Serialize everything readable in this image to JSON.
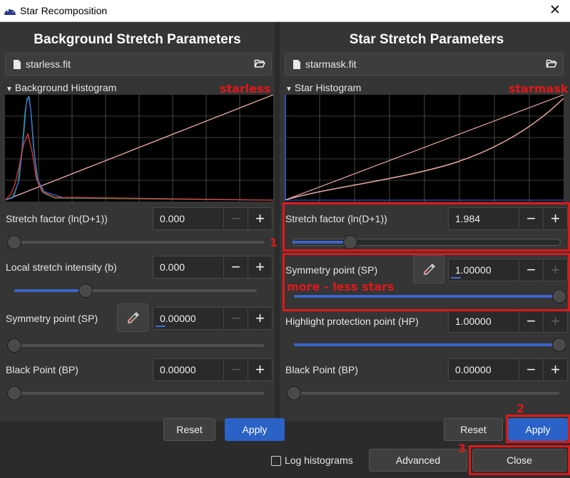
{
  "window": {
    "title": "Star Recomposition",
    "close_icon": "close-icon"
  },
  "left": {
    "heading": "Background Stretch Parameters",
    "file_name": "starless.fit",
    "histogram_title": "Background Histogram",
    "histogram_annotation": "starless",
    "params": {
      "stretch_factor": {
        "label": "Stretch factor (ln(D+1))",
        "value": "0.000",
        "slider_level": 0.0
      },
      "local_stretch": {
        "label": "Local stretch intensity (b)",
        "value": "0.000",
        "slider_level": 0.28
      },
      "symmetry_point": {
        "label": "Symmetry point (SP)",
        "value": "0.00000",
        "slider_level": 0.0
      },
      "black_point": {
        "label": "Black Point (BP)",
        "value": "0.00000",
        "slider_level": 0.0
      }
    },
    "reset_label": "Reset",
    "apply_label": "Apply"
  },
  "right": {
    "heading": "Star Stretch Parameters",
    "file_name": "starmask.fit",
    "histogram_title": "Star Histogram",
    "histogram_annotation": "starmask",
    "params": {
      "stretch_factor": {
        "label": "Stretch factor (ln(D+1))",
        "value": "1.984",
        "slider_level": 0.2
      },
      "symmetry_point": {
        "label": "Symmetry point (SP)",
        "value": "1.00000",
        "slider_level": 1.0
      },
      "highlight_protection": {
        "label": "Highlight protection point (HP)",
        "value": "1.00000",
        "slider_level": 1.0
      },
      "black_point": {
        "label": "Black Point (BP)",
        "value": "0.00000",
        "slider_level": 0.0
      }
    },
    "reset_label": "Reset",
    "apply_label": "Apply"
  },
  "footer": {
    "log_histograms_label": "Log histograms",
    "advanced_label": "Advanced",
    "close_label": "Close"
  },
  "annotations": {
    "marker_1": "1",
    "marker_2": "2",
    "marker_3": "3",
    "more_less_stars": "more - less stars",
    "color": "#e01818"
  },
  "colors": {
    "accent": "#2b62c7",
    "background": "#2b2b2b",
    "panel": "#353535"
  }
}
